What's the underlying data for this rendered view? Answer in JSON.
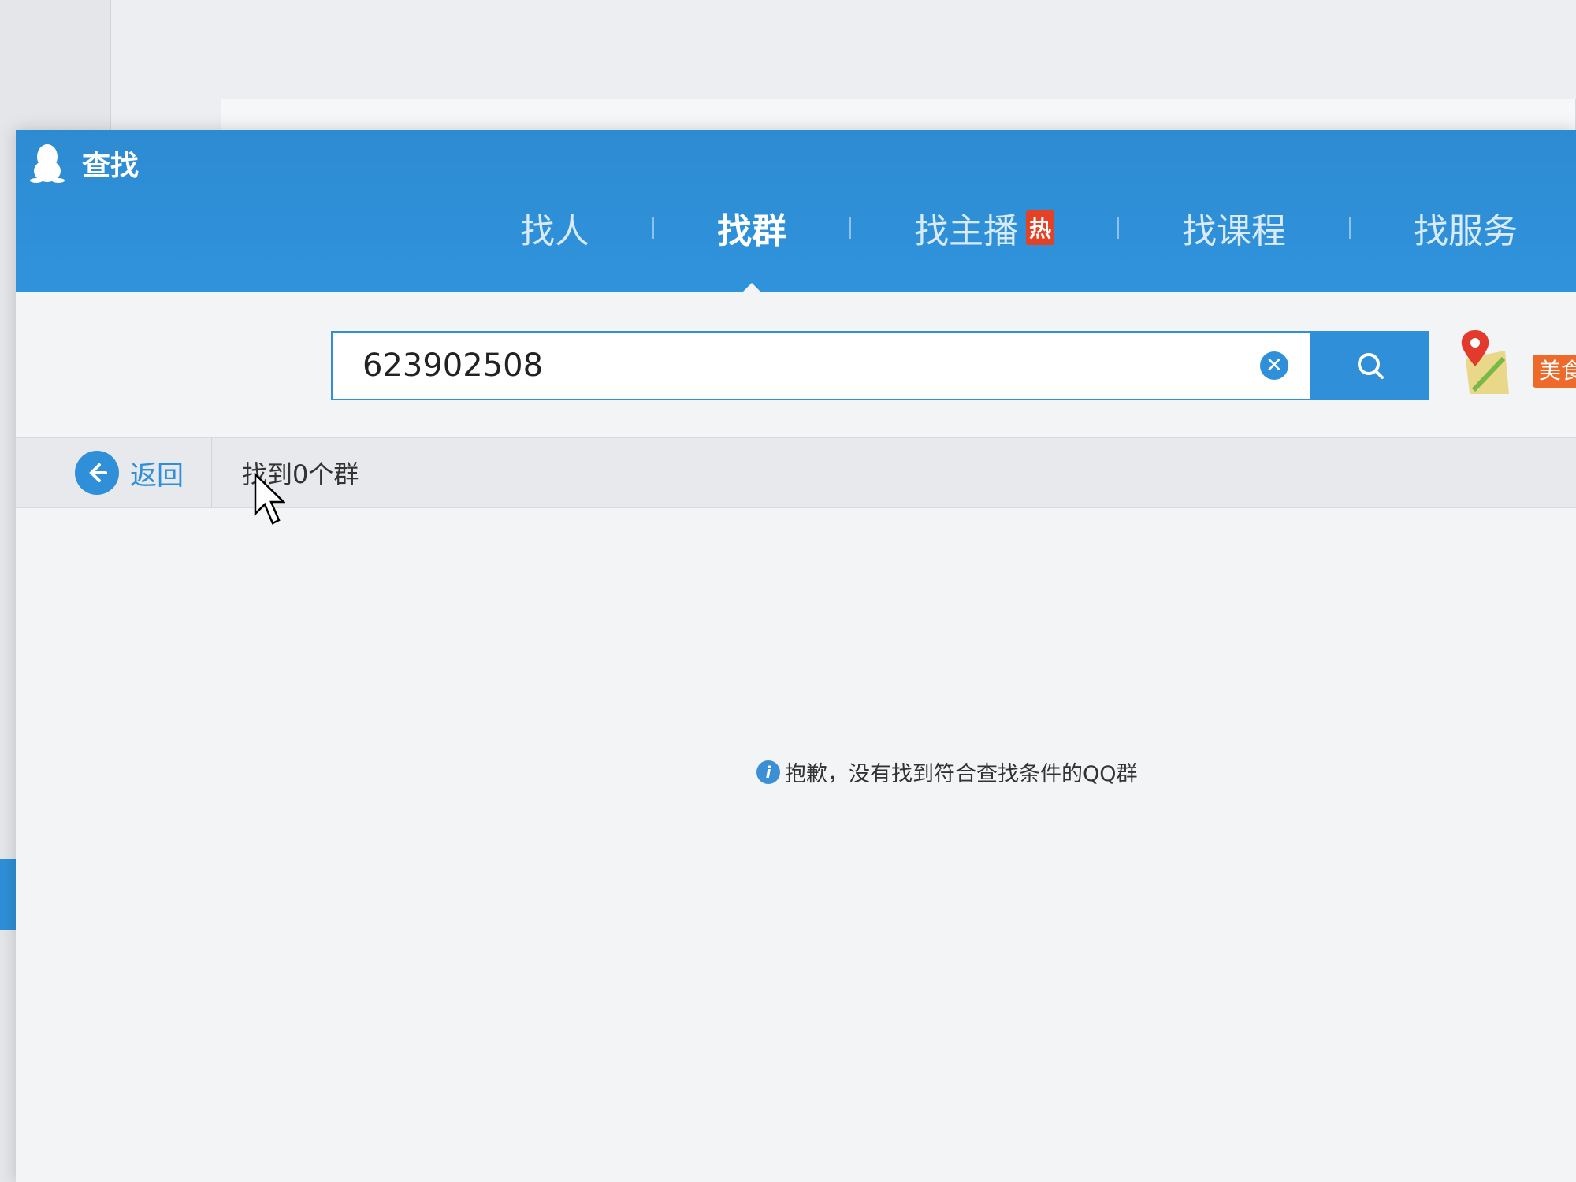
{
  "window": {
    "title": "查找"
  },
  "tabs": [
    {
      "label": "找人",
      "active": false
    },
    {
      "label": "找群",
      "active": true
    },
    {
      "label": "找主播",
      "active": false,
      "badge": "热"
    },
    {
      "label": "找课程",
      "active": false
    },
    {
      "label": "找服务",
      "active": false
    }
  ],
  "search": {
    "value": "623902508",
    "clear_icon": "close-circle-icon",
    "button_icon": "search-icon"
  },
  "side": {
    "map_icon": "map-pin-icon",
    "food_badge": "美食"
  },
  "results": {
    "back_label": "返回",
    "count_text": "找到0个群",
    "empty_message": "抱歉，没有找到符合查找条件的QQ群"
  },
  "colors": {
    "accent": "#2f8fd8",
    "hot": "#e34226",
    "food": "#ee6a2a"
  }
}
